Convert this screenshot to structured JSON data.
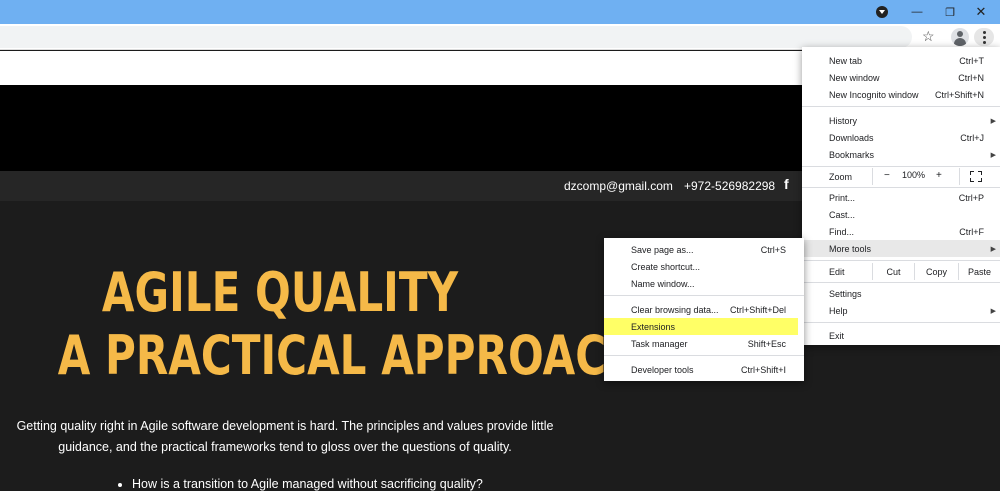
{
  "window": {
    "minimize_icon": "minimize-icon",
    "restore_icon": "restore-icon",
    "close_icon": "close-icon"
  },
  "contact": {
    "email": "dzcomp@gmail.com",
    "phone": "+972-526982298",
    "facebook": "f"
  },
  "hero": {
    "title_line1": "AGILE QUALITY",
    "title_line2": "A PRACTICAL APPROACH",
    "intro": "Getting quality right in Agile software development is hard. The principles and values provide little guidance, and the practical frameworks tend to gloss over the questions of quality.",
    "bullet": "How is a transition to Agile managed without sacrificing quality?",
    "accent_color": "#f5b948"
  },
  "menu": {
    "new_tab": {
      "label": "New tab",
      "shortcut": "Ctrl+T"
    },
    "new_window": {
      "label": "New window",
      "shortcut": "Ctrl+N"
    },
    "new_incognito": {
      "label": "New Incognito window",
      "shortcut": "Ctrl+Shift+N"
    },
    "history": {
      "label": "History"
    },
    "downloads": {
      "label": "Downloads",
      "shortcut": "Ctrl+J"
    },
    "bookmarks": {
      "label": "Bookmarks"
    },
    "zoom": {
      "label": "Zoom",
      "minus": "−",
      "value": "100%",
      "plus": "+"
    },
    "print": {
      "label": "Print...",
      "shortcut": "Ctrl+P"
    },
    "cast": {
      "label": "Cast..."
    },
    "find": {
      "label": "Find...",
      "shortcut": "Ctrl+F"
    },
    "more_tools": {
      "label": "More tools"
    },
    "edit": {
      "label": "Edit",
      "cut": "Cut",
      "copy": "Copy",
      "paste": "Paste"
    },
    "settings": {
      "label": "Settings"
    },
    "help": {
      "label": "Help"
    },
    "exit": {
      "label": "Exit"
    }
  },
  "submenu": {
    "save_page": {
      "label": "Save page as...",
      "shortcut": "Ctrl+S"
    },
    "create_shortcut": {
      "label": "Create shortcut..."
    },
    "name_window": {
      "label": "Name window..."
    },
    "clear_data": {
      "label": "Clear browsing data...",
      "shortcut": "Ctrl+Shift+Del"
    },
    "extensions": {
      "label": "Extensions",
      "highlight_color": "#ffff66"
    },
    "task_manager": {
      "label": "Task manager",
      "shortcut": "Shift+Esc"
    },
    "developer_tools": {
      "label": "Developer tools",
      "shortcut": "Ctrl+Shift+I"
    }
  }
}
